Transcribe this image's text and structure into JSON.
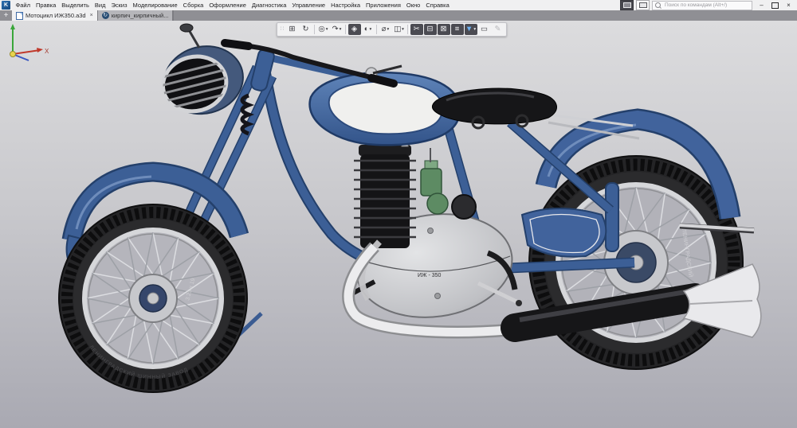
{
  "window": {
    "app_initial": "K",
    "search_placeholder": "Поиск по командам (Alt+/)",
    "controls": {
      "minimize": "–",
      "close": "×"
    }
  },
  "menu": {
    "items": [
      "Файл",
      "Правка",
      "Выделить",
      "Вид",
      "Эскиз",
      "Моделирование",
      "Сборка",
      "Оформление",
      "Диагностика",
      "Управление",
      "Настройка",
      "Приложения",
      "Окно",
      "Справка"
    ]
  },
  "tabs": {
    "new_tab": "+",
    "items": [
      {
        "label": "Мотоцикл ИЖ350.a3d",
        "close": "×",
        "active": true
      },
      {
        "label": "кирпич_кирпичный...",
        "icon_glyph": "↻",
        "active": false
      }
    ]
  },
  "toolbar": {
    "buttons": [
      {
        "name": "drag-handle",
        "glyph": "∷",
        "type": "handle"
      },
      {
        "name": "show-all",
        "glyph": "⊞"
      },
      {
        "name": "rebuild-model",
        "glyph": "↻"
      },
      {
        "sep": true
      },
      {
        "name": "zoom",
        "glyph": "◎",
        "dropdown": true
      },
      {
        "name": "rotate-view",
        "glyph": "↷",
        "dropdown": true
      },
      {
        "sep": true
      },
      {
        "name": "orientation-cube",
        "glyph": "◈",
        "pressed": true
      },
      {
        "name": "display-mode",
        "glyph": "◐",
        "dropdown": true
      },
      {
        "sep": true
      },
      {
        "name": "hide-objects",
        "glyph": "⌀",
        "dropdown": true
      },
      {
        "name": "hide-components",
        "glyph": "◫",
        "dropdown": true
      },
      {
        "sep": true
      },
      {
        "name": "clip-section",
        "glyph": "✂",
        "pressed": true
      },
      {
        "name": "section-view",
        "glyph": "⊟",
        "pressed": true
      },
      {
        "name": "zones",
        "glyph": "⊠",
        "pressed": true
      },
      {
        "name": "simplifications",
        "glyph": "≡",
        "pressed": true
      },
      {
        "name": "filter-objects",
        "glyph": "▼",
        "pressed": true,
        "accent": true,
        "dropdown": true
      },
      {
        "name": "selection-region",
        "glyph": "▭"
      },
      {
        "name": "edit-sketch",
        "glyph": "✎",
        "disabled": true
      }
    ]
  },
  "viewport": {
    "model": {
      "engine_label": "ИЖ - 350",
      "tire_size_rear": "3.25 x 19",
      "tire_size_front": "3.25 x 19",
      "tire_brand_rear": "ЛЕНИНГРАДСКИЙ",
      "tire_brand_front": "ЛЕНИНГРАДСКИЙ ШИННЫЙ ЗАВОД"
    },
    "triad": {
      "x_label": "X"
    }
  },
  "colors": {
    "frame_blue": "#3c5f96",
    "frame_blue_dark": "#24406b",
    "tank_blue_light": "#5a7fb5",
    "filter_accent": "#6db2f2"
  }
}
